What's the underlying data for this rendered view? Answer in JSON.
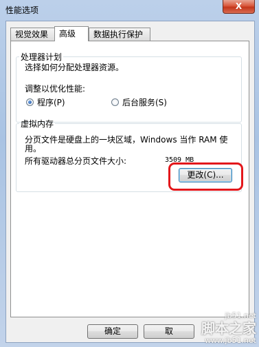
{
  "window": {
    "title": "性能选项",
    "close_label": "X"
  },
  "tabs": [
    {
      "label": "视觉效果"
    },
    {
      "label": "高级"
    },
    {
      "label": "数据执行保护"
    }
  ],
  "processor": {
    "legend": "处理器计划",
    "description": "选择如何分配处理器资源。",
    "adjust_label": "调整以优化性能:",
    "options": [
      {
        "label": "程序(P)",
        "selected": true
      },
      {
        "label": "后台服务(S)",
        "selected": false
      }
    ]
  },
  "virtual_memory": {
    "legend": "虚拟内存",
    "description_line1": "分页文件是硬盘上的一块区域，Windows 当作 RAM 使",
    "description_line2": "用。",
    "total_label": "所有驱动器总分页文件大小:",
    "total_value": "3509 MB",
    "change_button": "更改(C)..."
  },
  "footer": {
    "ok_button": "确定",
    "cancel_button": "取"
  },
  "watermark": {
    "site": "jb51.net",
    "brand": "脚本之家",
    "url": "www.jb51.net"
  },
  "colors": {
    "highlight": "#e3171b",
    "close": "#c4361a"
  }
}
